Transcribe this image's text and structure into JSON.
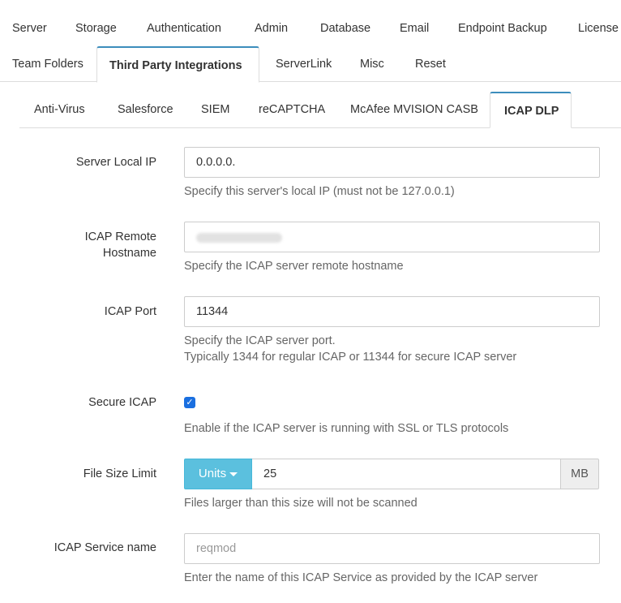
{
  "top_tabs_row1": [
    "Server",
    "Storage",
    "Authentication",
    "Admin",
    "Database",
    "Email",
    "Endpoint Backup",
    "License"
  ],
  "top_tabs_row2": [
    "Team Folders",
    "Third Party Integrations",
    "ServerLink",
    "Misc",
    "Reset"
  ],
  "sub_tabs": [
    "Anti-Virus",
    "Salesforce",
    "SIEM",
    "reCAPTCHA",
    "McAfee MVISION CASB",
    "ICAP DLP"
  ],
  "active_top_tab": "Third Party Integrations",
  "active_sub_tab": "ICAP DLP",
  "accent_color": "#3c8dbc",
  "form": {
    "server_local_ip": {
      "label": "Server Local IP",
      "value": "0.0.0.0.",
      "help": "Specify this server's local IP (must not be 127.0.0.1)"
    },
    "icap_remote_hostname": {
      "label_line1": "ICAP Remote",
      "label_line2": "Hostname",
      "help": "Specify the ICAP server remote hostname"
    },
    "icap_port": {
      "label": "ICAP Port",
      "value": "11344",
      "help_line1": "Specify the ICAP server port.",
      "help_line2": "Typically 1344 for regular ICAP or 11344 for secure ICAP server"
    },
    "secure_icap": {
      "label": "Secure ICAP",
      "checked": true,
      "check_glyph": "✓",
      "help": "Enable if the ICAP server is running with SSL or TLS protocols"
    },
    "file_size_limit": {
      "label": "File Size Limit",
      "units_label": "Units",
      "value": "25",
      "unit": "MB",
      "help": "Files larger than this size will not be scanned"
    },
    "icap_service_name": {
      "label": "ICAP Service name",
      "placeholder": "reqmod",
      "help": "Enter the name of this ICAP Service as provided by the ICAP server"
    }
  }
}
